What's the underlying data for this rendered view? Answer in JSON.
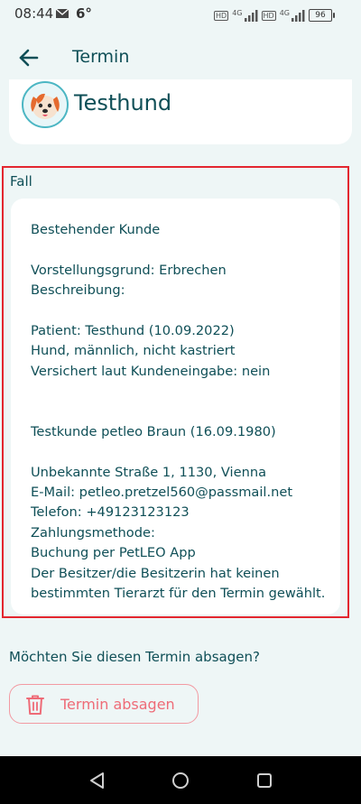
{
  "status_bar": {
    "time": "08:44",
    "temperature": "6°",
    "network_label_1": "4G",
    "network_label_2": "4G",
    "hd_label_1": "HD",
    "hd_label_2": "HD",
    "battery": "96"
  },
  "app_bar": {
    "title": "Termin"
  },
  "pet": {
    "name": "Testhund"
  },
  "fall": {
    "label": "Fall",
    "lines": [
      "Bestehender Kunde",
      "",
      "Vorstellungsgrund: Erbrechen",
      "Beschreibung:",
      "",
      "Patient: Testhund (10.09.2022)",
      "Hund, männlich, nicht kastriert",
      "Versichert laut Kundeneingabe: nein",
      "",
      "",
      "Testkunde petleo Braun (16.09.1980)",
      "",
      "Unbekannte Straße 1, 1130, Vienna",
      "E-Mail: petleo.pretzel560@passmail.net",
      "Telefon: +49123123123",
      "Zahlungsmethode:",
      "Buchung per PetLEO App",
      "Der Besitzer/die Besitzerin hat keinen",
      "bestimmten Tierarzt für den Termin gewählt."
    ]
  },
  "cancel": {
    "question": "Möchten Sie diesen Termin absagen?",
    "button_label": "Termin absagen"
  },
  "colors": {
    "accent": "#0f4f57",
    "danger": "#ee6b77",
    "highlight_border": "#e3262f",
    "background": "#eef6f6"
  }
}
